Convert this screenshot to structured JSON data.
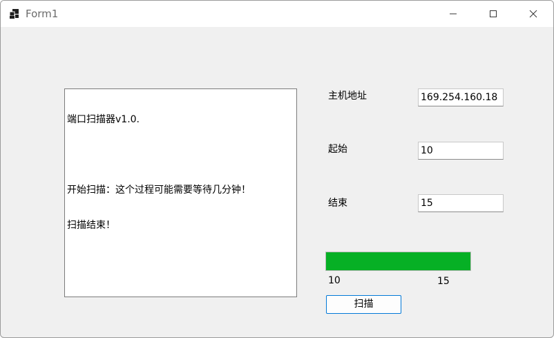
{
  "window": {
    "title": "Form1",
    "controls": {
      "minimize": "minimize-icon",
      "maximize": "maximize-icon",
      "close": "close-icon"
    }
  },
  "log": {
    "lines": [
      "端口扫描器v1.0.",
      "",
      "开始扫描：这个过程可能需要等待几分钟！",
      "扫描结束！"
    ]
  },
  "form": {
    "host_label": "主机地址",
    "host_value": "169.254.160.18",
    "start_label": "起始",
    "start_value": "10",
    "end_label": "结束",
    "end_value": "15"
  },
  "progress": {
    "percent": 100,
    "min_label": "10",
    "max_label": "15",
    "fill_color": "#06b025"
  },
  "actions": {
    "scan_label": "扫描"
  }
}
